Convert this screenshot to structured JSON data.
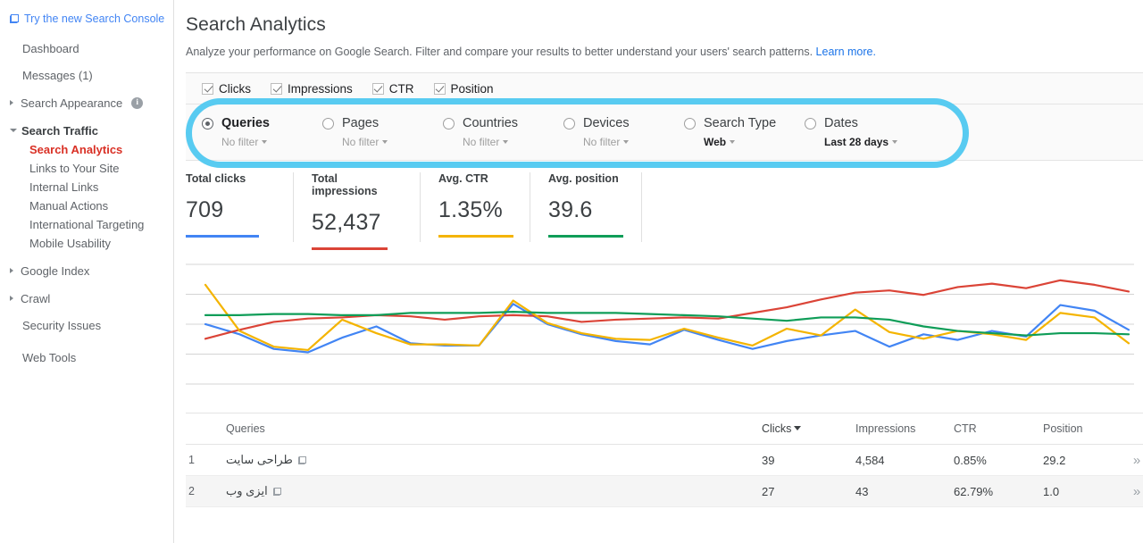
{
  "sidebar": {
    "promo": {
      "label": "Try the new Search Console",
      "icon": "external-link-icon"
    },
    "dashboard": "Dashboard",
    "messages": "Messages (1)",
    "groups": [
      {
        "label": "Search Appearance",
        "expanded": false,
        "info": true
      },
      {
        "label": "Search Traffic",
        "expanded": true
      }
    ],
    "traffic_items": [
      "Search Analytics",
      "Links to Your Site",
      "Internal Links",
      "Manual Actions",
      "International Targeting",
      "Mobile Usability"
    ],
    "active_item": "Search Analytics",
    "google_index": "Google Index",
    "crawl": "Crawl",
    "security_issues": "Security Issues",
    "web_tools": "Web Tools"
  },
  "header": {
    "title": "Search Analytics",
    "description": "Analyze your performance on Google Search. Filter and compare your results to better understand your users' search patterns.",
    "learn_more": "Learn more."
  },
  "metrics_toggles": [
    {
      "label": "Clicks",
      "checked": true
    },
    {
      "label": "Impressions",
      "checked": true
    },
    {
      "label": "CTR",
      "checked": true
    },
    {
      "label": "Position",
      "checked": true
    }
  ],
  "filters": [
    {
      "name": "Queries",
      "value": "No filter",
      "selected": true,
      "bold_value": false
    },
    {
      "name": "Pages",
      "value": "No filter",
      "selected": false,
      "bold_value": false
    },
    {
      "name": "Countries",
      "value": "No filter",
      "selected": false,
      "bold_value": false
    },
    {
      "name": "Devices",
      "value": "No filter",
      "selected": false,
      "bold_value": false
    },
    {
      "name": "Search Type",
      "value": "Web",
      "selected": false,
      "bold_value": true
    },
    {
      "name": "Dates",
      "value": "Last 28 days",
      "selected": false,
      "bold_value": true
    }
  ],
  "annotation": {
    "shape": "rounded-rectangle-highlight",
    "color": "#4fc8f0"
  },
  "cards": [
    {
      "label": "Total clicks",
      "value": "709",
      "color": "#4285f4"
    },
    {
      "label": "Total impressions",
      "value": "52,437",
      "color": "#db4437"
    },
    {
      "label": "Avg. CTR",
      "value": "1.35%",
      "color": "#f4b400"
    },
    {
      "label": "Avg. position",
      "value": "39.6",
      "color": "#0f9d58"
    }
  ],
  "chart_data": {
    "type": "line",
    "title": "",
    "xlabel": "",
    "ylabel": "",
    "grid": true,
    "legend": "none",
    "gridline_count": 5,
    "x": [
      1,
      2,
      3,
      4,
      5,
      6,
      7,
      8,
      9,
      10,
      11,
      12,
      13,
      14,
      15,
      16,
      17,
      18,
      19,
      20,
      21,
      22,
      23,
      24,
      25,
      26,
      27,
      28
    ],
    "series": [
      {
        "name": "Clicks",
        "color": "#4285f4",
        "values": [
          50,
          41,
          28,
          25,
          38,
          48,
          33,
          31,
          31,
          68,
          50,
          41,
          35,
          32,
          45,
          36,
          28,
          35,
          40,
          44,
          30,
          41,
          36,
          44,
          39,
          67,
          62,
          45
        ]
      },
      {
        "name": "Impressions",
        "color": "#db4437",
        "values": [
          37,
          45,
          52,
          55,
          56,
          58,
          57,
          54,
          57,
          58,
          57,
          52,
          54,
          55,
          56,
          55,
          60,
          65,
          72,
          78,
          80,
          76,
          83,
          86,
          82,
          89,
          85,
          79
        ]
      },
      {
        "name": "CTR",
        "color": "#f4b400",
        "values": [
          85,
          44,
          30,
          27,
          54,
          42,
          32,
          32,
          31,
          71,
          51,
          42,
          37,
          36,
          46,
          38,
          31,
          46,
          40,
          63,
          43,
          37,
          44,
          41,
          36,
          60,
          56,
          33
        ]
      },
      {
        "name": "Position",
        "color": "#0f9d58",
        "values": [
          58,
          58,
          59,
          59,
          58,
          58,
          60,
          60,
          60,
          61,
          60,
          60,
          60,
          59,
          58,
          57,
          55,
          53,
          56,
          56,
          54,
          48,
          44,
          42,
          40,
          42,
          42,
          41
        ]
      }
    ]
  },
  "table": {
    "columns": {
      "index": "",
      "queries": "Queries",
      "clicks": "Clicks",
      "impressions": "Impressions",
      "ctr": "CTR",
      "position": "Position"
    },
    "sorted_by": "Clicks",
    "sort_direction": "desc",
    "rows": [
      {
        "index": "1",
        "query": "طراحی سایت",
        "clicks": "39",
        "impressions": "4,584",
        "ctr": "0.85%",
        "position": "29.2",
        "expand": "»"
      },
      {
        "index": "2",
        "query": "ایزی وب",
        "clicks": "27",
        "impressions": "43",
        "ctr": "62.79%",
        "position": "1.0",
        "expand": "»"
      }
    ]
  }
}
